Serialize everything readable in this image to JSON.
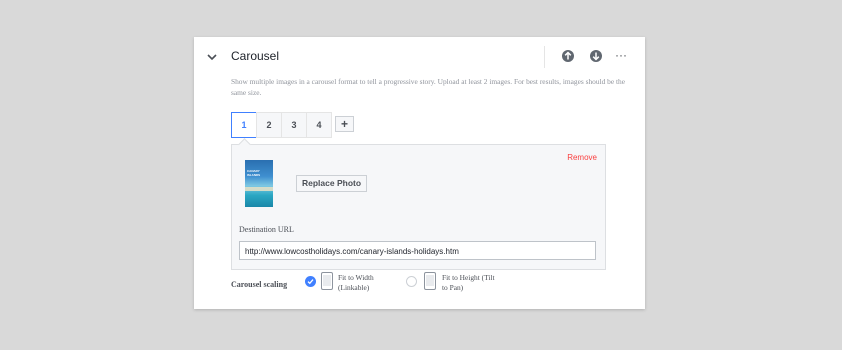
{
  "header": {
    "title": "Carousel",
    "more_label": "···"
  },
  "description": "Show multiple images in a carousel format to tell a progressive story. Upload at least 2 images. For best results, images should be the same size.",
  "tabs": [
    {
      "label": "1",
      "active": true
    },
    {
      "label": "2",
      "active": false
    },
    {
      "label": "3",
      "active": false
    },
    {
      "label": "4",
      "active": false
    }
  ],
  "add_tab_label": "+",
  "card_panel": {
    "remove_label": "Remove",
    "thumbnail_text": "CANARY ISLANDS",
    "replace_photo_label": "Replace Photo",
    "destination_label": "Destination URL",
    "destination_url": "http://www.lowcostholidays.com/canary-islands-holidays.htm"
  },
  "scaling": {
    "label": "Carousel scaling",
    "options": [
      {
        "label": "Fit to Width (Linkable)",
        "selected": true
      },
      {
        "label": "Fit to Height (Tilt to Pan)",
        "selected": false
      }
    ]
  },
  "colors": {
    "accent": "#4080ff",
    "remove": "#fa3e3e",
    "background": "#d9d9d9"
  },
  "icons": {
    "collapse": "chevron-down-icon",
    "move_up": "arrow-up-circle-icon",
    "move_down": "arrow-down-circle-icon",
    "more": "more-icon"
  }
}
